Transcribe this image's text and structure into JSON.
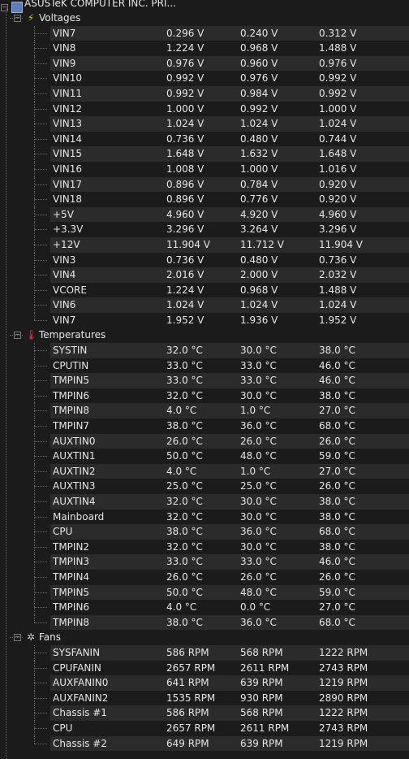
{
  "root": {
    "label": "ASUSTeK COMPUTER INC. PRI...",
    "icon": "motherboard-icon"
  },
  "groups": [
    {
      "label": "Voltages",
      "icon": "voltage-icon",
      "icon_color": "#e8c200",
      "rows": [
        [
          "VIN7",
          "0.296 V",
          "0.240 V",
          "0.312 V"
        ],
        [
          "VIN8",
          "1.224 V",
          "0.968 V",
          "1.488 V"
        ],
        [
          "VIN9",
          "0.976 V",
          "0.960 V",
          "0.976 V"
        ],
        [
          "VIN10",
          "0.992 V",
          "0.976 V",
          "0.992 V"
        ],
        [
          "VIN11",
          "0.992 V",
          "0.984 V",
          "0.992 V"
        ],
        [
          "VIN12",
          "1.000 V",
          "0.992 V",
          "1.000 V"
        ],
        [
          "VIN13",
          "1.024 V",
          "1.024 V",
          "1.024 V"
        ],
        [
          "VIN14",
          "0.736 V",
          "0.480 V",
          "0.744 V"
        ],
        [
          "VIN15",
          "1.648 V",
          "1.632 V",
          "1.648 V"
        ],
        [
          "VIN16",
          "1.008 V",
          "1.000 V",
          "1.016 V"
        ],
        [
          "VIN17",
          "0.896 V",
          "0.784 V",
          "0.920 V"
        ],
        [
          "VIN18",
          "0.896 V",
          "0.776 V",
          "0.920 V"
        ],
        [
          "+5V",
          "4.960 V",
          "4.920 V",
          "4.960 V"
        ],
        [
          "+3.3V",
          "3.296 V",
          "3.264 V",
          "3.296 V"
        ],
        [
          "+12V",
          "11.904 V",
          "11.712 V",
          "11.904 V"
        ],
        [
          "VIN3",
          "0.736 V",
          "0.480 V",
          "0.736 V"
        ],
        [
          "VIN4",
          "2.016 V",
          "2.000 V",
          "2.032 V"
        ],
        [
          "VCORE",
          "1.224 V",
          "0.968 V",
          "1.488 V"
        ],
        [
          "VIN6",
          "1.024 V",
          "1.024 V",
          "1.024 V"
        ],
        [
          "VIN7",
          "1.952 V",
          "1.936 V",
          "1.952 V"
        ]
      ]
    },
    {
      "label": "Temperatures",
      "icon": "thermometer-icon",
      "icon_color": "#d04040",
      "rows": [
        [
          "SYSTIN",
          "32.0 °C",
          "30.0 °C",
          "38.0 °C"
        ],
        [
          "CPUTIN",
          "33.0 °C",
          "33.0 °C",
          "46.0 °C"
        ],
        [
          "TMPIN5",
          "33.0 °C",
          "33.0 °C",
          "46.0 °C"
        ],
        [
          "TMPIN6",
          "32.0 °C",
          "30.0 °C",
          "38.0 °C"
        ],
        [
          "TMPIN8",
          "4.0 °C",
          "1.0 °C",
          "27.0 °C"
        ],
        [
          "TMPIN7",
          "38.0 °C",
          "36.0 °C",
          "68.0 °C"
        ],
        [
          "AUXTIN0",
          "26.0 °C",
          "26.0 °C",
          "26.0 °C"
        ],
        [
          "AUXTIN1",
          "50.0 °C",
          "48.0 °C",
          "59.0 °C"
        ],
        [
          "AUXTIN2",
          "4.0 °C",
          "1.0 °C",
          "27.0 °C"
        ],
        [
          "AUXTIN3",
          "25.0 °C",
          "25.0 °C",
          "26.0 °C"
        ],
        [
          "AUXTIN4",
          "32.0 °C",
          "30.0 °C",
          "38.0 °C"
        ],
        [
          "Mainboard",
          "32.0 °C",
          "30.0 °C",
          "38.0 °C"
        ],
        [
          "CPU",
          "38.0 °C",
          "36.0 °C",
          "68.0 °C"
        ],
        [
          "TMPIN2",
          "32.0 °C",
          "30.0 °C",
          "38.0 °C"
        ],
        [
          "TMPIN3",
          "33.0 °C",
          "33.0 °C",
          "46.0 °C"
        ],
        [
          "TMPIN4",
          "26.0 °C",
          "26.0 °C",
          "26.0 °C"
        ],
        [
          "TMPIN5",
          "50.0 °C",
          "48.0 °C",
          "59.0 °C"
        ],
        [
          "TMPIN6",
          "4.0 °C",
          "0.0 °C",
          "27.0 °C"
        ],
        [
          "TMPIN8",
          "38.0 °C",
          "36.0 °C",
          "68.0 °C"
        ]
      ]
    },
    {
      "label": "Fans",
      "icon": "fan-icon",
      "icon_color": "#c8c8c8",
      "rows": [
        [
          "SYSFANIN",
          "586 RPM",
          "568 RPM",
          "1222 RPM"
        ],
        [
          "CPUFANIN",
          "2657 RPM",
          "2611 RPM",
          "2743 RPM"
        ],
        [
          "AUXFANIN0",
          "641 RPM",
          "639 RPM",
          "1219 RPM"
        ],
        [
          "AUXFANIN2",
          "1535 RPM",
          "930 RPM",
          "2890 RPM"
        ],
        [
          "Chassis #1",
          "586 RPM",
          "568 RPM",
          "1222 RPM"
        ],
        [
          "CPU",
          "2657 RPM",
          "2611 RPM",
          "2743 RPM"
        ],
        [
          "Chassis #2",
          "649 RPM",
          "639 RPM",
          "1219 RPM"
        ]
      ]
    }
  ],
  "colors": {
    "background": "#1b1b1b",
    "row_alt": "#2b2b2b",
    "text": "#e6e6e6"
  }
}
